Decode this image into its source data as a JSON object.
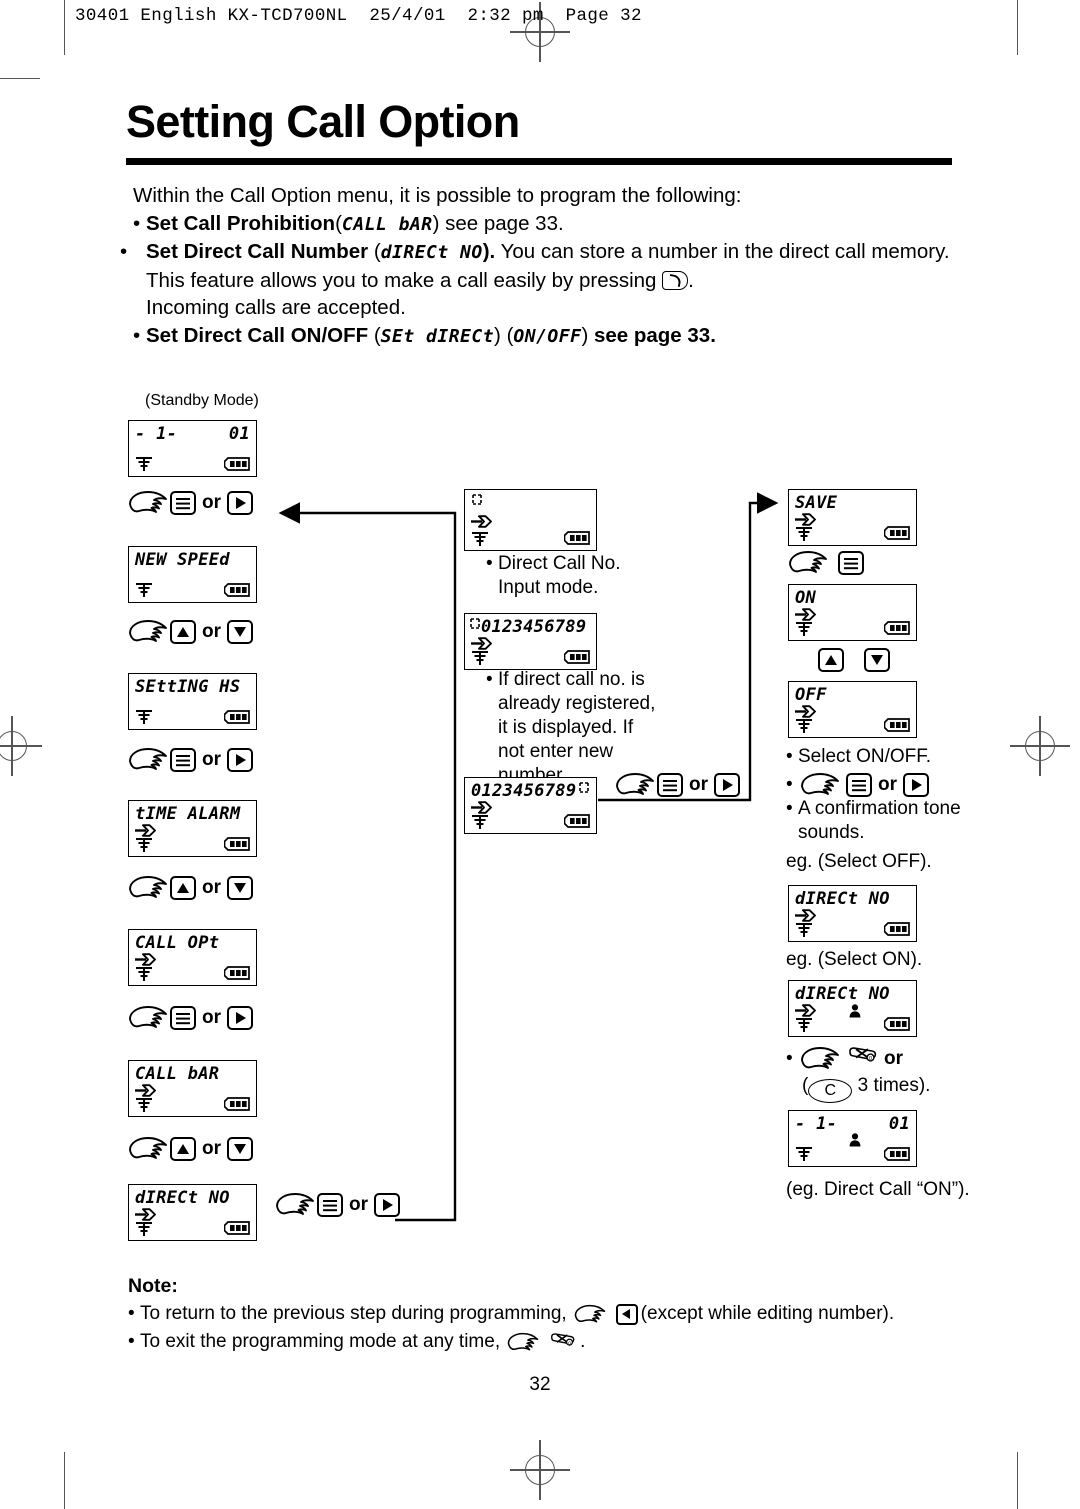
{
  "header": {
    "line": "30401 English KX-TCD700NL  25/4/01  2:32 pm  Page 32"
  },
  "title": "Setting Call Option",
  "intro": {
    "lead": "Within the Call Option menu, it is possible to program the following:",
    "bullets": [
      {
        "bold": "Set Call Prohibition",
        "seg_open": "(",
        "seg": "CALL bAR",
        "seg_close": ")",
        "tail": " see page 33."
      },
      {
        "bold": "Set Direct Call Number",
        "seg_open": "(",
        "seg": "dIRECt NO",
        "seg_close": ").",
        "tail": " You can store a number in the direct call memory. This feature allows you to make a call easily by pressing",
        "tail2": ".",
        "tail3": "Incoming calls are accepted."
      },
      {
        "bold": "Set Direct Call ON/OFF",
        "seg_open": "(",
        "seg": "SEt dIRECt",
        "seg_mid": ") (",
        "seg2": "ON/OFF",
        "seg_close": ")",
        "tail": " see page 33."
      }
    ]
  },
  "flow": {
    "standby_caption": "(Standby Mode)",
    "left_column": {
      "screens": [
        {
          "text_left": "- 1-",
          "text_right": "01",
          "arrow": false,
          "antenna": true,
          "battery": true
        },
        {
          "text_left": "NEW SPEEd",
          "text_right": "",
          "arrow": false,
          "antenna": true,
          "battery": true
        },
        {
          "text_left": "SEttING HS",
          "text_right": "",
          "arrow": false,
          "antenna": true,
          "battery": true
        },
        {
          "text_left": "tIME ALARM",
          "text_right": "",
          "arrow": true,
          "antenna": true,
          "battery": true
        },
        {
          "text_left": "CALL OPt",
          "text_right": "",
          "arrow": true,
          "antenna": true,
          "battery": true
        },
        {
          "text_left": "CALL bAR",
          "text_right": "",
          "arrow": true,
          "antenna": true,
          "battery": true
        },
        {
          "text_left": "dIRECt NO",
          "text_right": "",
          "arrow": true,
          "antenna": true,
          "battery": true
        }
      ],
      "steps": [
        {
          "keys": [
            "menu-icon",
            "right-arrow-icon"
          ],
          "or": "or"
        },
        {
          "keys": [
            "up-arrow-icon",
            "down-arrow-icon"
          ],
          "or": "or"
        },
        {
          "keys": [
            "menu-icon",
            "right-arrow-icon"
          ],
          "or": "or"
        },
        {
          "keys": [
            "up-arrow-icon",
            "down-arrow-icon"
          ],
          "or": "or"
        },
        {
          "keys": [
            "menu-icon",
            "right-arrow-icon"
          ],
          "or": "or"
        },
        {
          "keys": [
            "up-arrow-icon",
            "down-arrow-icon"
          ],
          "or": "or"
        }
      ],
      "exit_step": {
        "or": "or"
      }
    },
    "middle_column": {
      "screens": [
        {
          "text_left": "",
          "cursor": true,
          "arrow": true,
          "antenna": true,
          "battery": true
        },
        {
          "text_left": "0123456789",
          "cursor_lead": true,
          "arrow": true,
          "antenna": true,
          "battery": true
        },
        {
          "text_left": "0123456789",
          "cursor_trail": true,
          "arrow": true,
          "antenna": true,
          "battery": true
        }
      ],
      "captions": [
        "Direct Call No.\nInput mode.",
        "If direct call no. is\nalready registered,\nit is displayed. If\nnot enter new\nnumber."
      ],
      "caption_lines_1": [
        "Direct Call No.",
        "Input mode."
      ],
      "caption_lines_2": [
        "If direct call no. is",
        "already registered,",
        "it is displayed. If",
        "not enter new",
        "number."
      ],
      "step": {
        "or": "or"
      }
    },
    "right_column": {
      "screens": [
        {
          "text_left": "SAVE",
          "arrow": true,
          "antenna": true,
          "battery": true
        },
        {
          "text_left": "ON",
          "arrow": true,
          "antenna": true,
          "battery": true
        },
        {
          "text_left": "OFF",
          "arrow": true,
          "antenna": true,
          "battery": true
        },
        {
          "text_left": "dIRECt NO",
          "arrow": true,
          "antenna": true,
          "battery": true,
          "person": false
        },
        {
          "text_left": "dIRECt NO",
          "arrow": true,
          "antenna": true,
          "battery": true,
          "person": true
        },
        {
          "text_left": "- 1-",
          "text_right": "01",
          "arrow": false,
          "antenna": true,
          "battery": true,
          "person": true
        }
      ],
      "notes": [
        "Select ON/OFF.",
        "A confirmation tone",
        "sounds."
      ],
      "note_confirm_l1": "A confirmation tone",
      "note_confirm_l2": "sounds.",
      "eg_off": "eg. (Select OFF).",
      "eg_on": "eg. (Select ON).",
      "times_pre": "(",
      "times_key": "C",
      "times_post": "3 times).",
      "eg_final": "(eg. Direct Call “ON”).",
      "or_label": "or",
      "or_label2": "or"
    }
  },
  "notes": {
    "heading": "Note:",
    "items": [
      {
        "pre": "To return to the previous step during programming,",
        "post": "(except while editing number)."
      },
      {
        "pre": "To exit the programming mode at any time,",
        "post": "."
      }
    ]
  },
  "page_number": "32"
}
